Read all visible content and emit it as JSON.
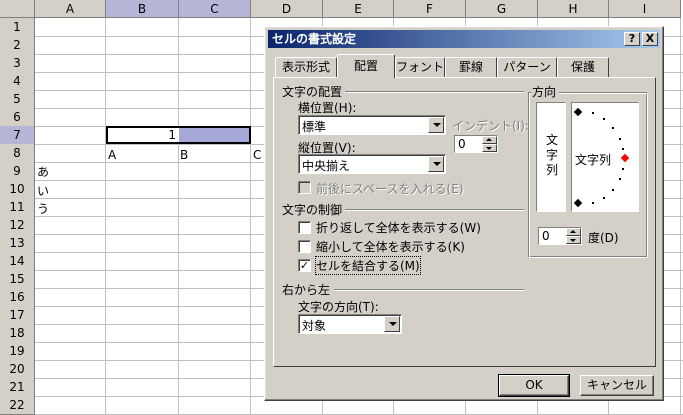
{
  "sheet": {
    "columns": [
      "A",
      "B",
      "C",
      "D",
      "E",
      "F",
      "G",
      "H",
      "I"
    ],
    "rows": [
      "1",
      "2",
      "3",
      "4",
      "5",
      "6",
      "7",
      "8",
      "9",
      "10",
      "11",
      "12",
      "13",
      "14",
      "15",
      "16",
      "17",
      "18",
      "19",
      "20",
      "21",
      "22"
    ],
    "selected_columns": [
      "B",
      "C"
    ],
    "selected_row": "7",
    "merged_cell_value": "1",
    "row8_labels": [
      "A",
      "B",
      "C"
    ],
    "col_a_values": [
      "あ",
      "い",
      "う"
    ]
  },
  "dialog": {
    "title": "セルの書式設定",
    "help_button": "?",
    "close_button": "X",
    "tabs": [
      "表示形式",
      "配置",
      "フォント",
      "罫線",
      "パターン",
      "保護"
    ],
    "active_tab": "配置",
    "text_alignment_group": "文字の配置",
    "horizontal_label": "横位置(H):",
    "horizontal_value": "標準",
    "indent_label": "インデント(I):",
    "indent_value": "0",
    "vertical_label": "縦位置(V):",
    "vertical_value": "中央揃え",
    "distributed_label": "前後にスペースを入れる(E)",
    "text_control_group": "文字の制御",
    "wrap_text_label": "折り返して全体を表示する(W)",
    "wrap_text_checked": false,
    "shrink_label": "縮小して全体を表示する(K)",
    "shrink_checked": false,
    "merge_label": "セルを結合する(M)",
    "merge_checked": true,
    "rtl_group": "右から左",
    "text_direction_label": "文字の方向(T):",
    "text_direction_value": "対象",
    "orientation_group": "方向",
    "vertical_text": "文字列",
    "orientation_text": "文字列",
    "degrees_value": "0",
    "degrees_label": "度(D)",
    "ok_button": "OK",
    "cancel_button": "キャンセル",
    "title_gradient_start": "#0a246a",
    "title_gradient_end": "#a6caf0"
  }
}
